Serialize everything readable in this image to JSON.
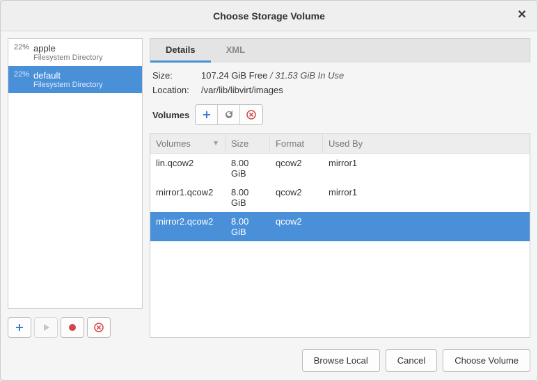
{
  "title": "Choose Storage Volume",
  "pools": [
    {
      "pct": "22%",
      "name": "apple",
      "type": "Filesystem Directory",
      "selected": false
    },
    {
      "pct": "22%",
      "name": "default",
      "type": "Filesystem Directory",
      "selected": true
    }
  ],
  "tabs": {
    "details": "Details",
    "xml": "XML"
  },
  "details": {
    "size_label": "Size:",
    "size_free": "107.24 GiB Free",
    "size_sep": " / ",
    "size_inuse": "31.53 GiB In Use",
    "location_label": "Location:",
    "location_value": "/var/lib/libvirt/images"
  },
  "volumes_label": "Volumes",
  "table": {
    "headers": {
      "volumes": "Volumes",
      "size": "Size",
      "format": "Format",
      "used_by": "Used By"
    },
    "rows": [
      {
        "vol": "lin.qcow2",
        "size": "8.00 GiB",
        "fmt": "qcow2",
        "used": "mirror1",
        "selected": false
      },
      {
        "vol": "mirror1.qcow2",
        "size": "8.00 GiB",
        "fmt": "qcow2",
        "used": "mirror1",
        "selected": false
      },
      {
        "vol": "mirror2.qcow2",
        "size": "8.00 GiB",
        "fmt": "qcow2",
        "used": "",
        "selected": true
      }
    ]
  },
  "footer": {
    "browse": "Browse Local",
    "cancel": "Cancel",
    "choose": "Choose Volume"
  }
}
